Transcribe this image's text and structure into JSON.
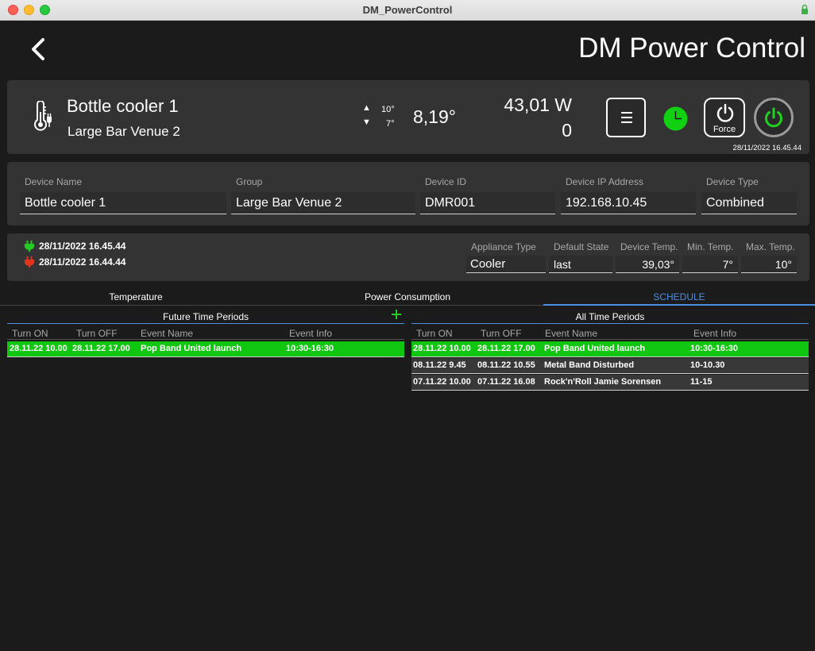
{
  "window": {
    "title": "DM_PowerControl"
  },
  "header": {
    "title": "DM Power Control"
  },
  "device": {
    "name": "Bottle cooler 1",
    "group": "Large Bar Venue 2",
    "temp_max": "10°",
    "temp_min": "7°",
    "temperature": "8,19°",
    "power": "43,01 W",
    "count": "0",
    "force_label": "Force",
    "timestamp": "28/11/2022 16.45.44"
  },
  "fields": [
    {
      "label": "Device Name",
      "value": "Bottle cooler 1"
    },
    {
      "label": "Group",
      "value": "Large Bar Venue 2"
    },
    {
      "label": "Device ID",
      "value": "DMR001"
    },
    {
      "label": "Device IP Address",
      "value": "192.168.10.45"
    },
    {
      "label": "Device Type",
      "value": "Combined"
    }
  ],
  "status": {
    "plug_on": "28/11/2022 16.45.44",
    "plug_off": "28/11/2022 16.44.44",
    "plug_on_color": "#22cc22",
    "plug_off_color": "#e2351e"
  },
  "settings": [
    {
      "label": "Appliance Type",
      "value": "Cooler"
    },
    {
      "label": "Default State",
      "value": "last"
    },
    {
      "label": "Device Temp.",
      "value": "39,03°"
    },
    {
      "label": "Min. Temp.",
      "value": "7°"
    },
    {
      "label": "Max. Temp.",
      "value": "10°"
    }
  ],
  "tabs": [
    {
      "label": "Temperature"
    },
    {
      "label": "Power Consumption"
    },
    {
      "label": "SCHEDULE"
    }
  ],
  "future": {
    "title": "Future Time Periods",
    "columns": [
      "Turn ON",
      "Turn OFF",
      "Event Name",
      "Event Info"
    ],
    "rows": [
      {
        "on": "28.11.22 10.00",
        "off": "28.11.22 17.00",
        "name": "Pop Band United launch",
        "info": "10:30-16:30"
      }
    ]
  },
  "all": {
    "title": "All Time Periods",
    "columns": [
      "Turn ON",
      "Turn OFF",
      "Event Name",
      "Event Info"
    ],
    "rows": [
      {
        "on": "28.11.22 10.00",
        "off": "28.11.22 17.00",
        "name": "Pop Band United launch",
        "info": "10:30-16:30"
      },
      {
        "on": "08.11.22 9.45",
        "off": "08.11.22 10.55",
        "name": "Metal Band Disturbed",
        "info": "10-10.30"
      },
      {
        "on": "07.11.22 10.00",
        "off": "07.11.22 16.08",
        "name": "Rock'n'Roll Jamie Sorensen",
        "info": "11-15"
      }
    ]
  },
  "colors": {
    "accent": "#4a8fe4",
    "active_green": "#11c611",
    "panel": "#333333"
  }
}
